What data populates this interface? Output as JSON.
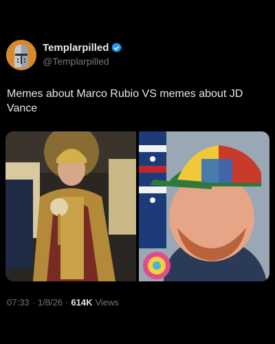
{
  "author": {
    "display_name": "Templarpilled",
    "handle": "@Templarpilled",
    "verified": true,
    "avatar_icon": "templar-helmet-icon"
  },
  "post": {
    "text": "Memes about Marco Rubio VS memes about JD Vance"
  },
  "media": {
    "left_icon": "emperor-figure-image",
    "right_icon": "propeller-cap-man-image"
  },
  "meta": {
    "time": "07:33",
    "separator": "·",
    "date": "1/8/26",
    "views_count": "614K",
    "views_label": "Views"
  },
  "colors": {
    "background": "#000000",
    "text": "#e7e9ea",
    "secondary": "#71767b",
    "verified_blue": "#1d9bf0"
  }
}
